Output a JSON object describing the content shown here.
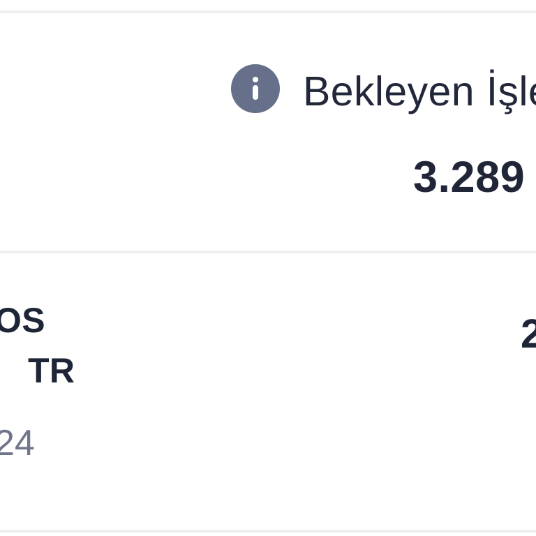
{
  "pending_summary": {
    "label": "Bekleyen İşle",
    "amount": "3.289",
    "icon": "info-icon"
  },
  "transaction": {
    "merchant_line_1": "OS",
    "merchant_line_2": "TR",
    "date": "24",
    "amount": "2"
  },
  "colors": {
    "background": "#ffffff",
    "divider": "#eeeeee",
    "primary_text": "#1f2638",
    "secondary_text": "#6f768a",
    "info_icon_background": "#66708a"
  }
}
